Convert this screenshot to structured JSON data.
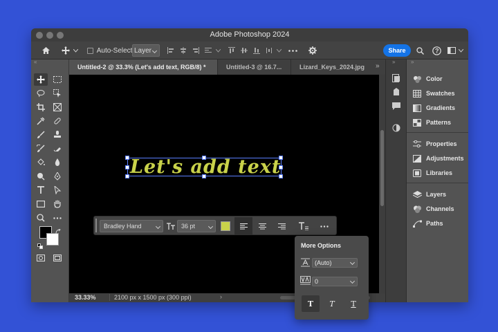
{
  "window": {
    "title": "Adobe Photoshop 2024"
  },
  "options_bar": {
    "auto_select_label": "Auto-Select:",
    "auto_select_value": "Layer",
    "share_label": "Share"
  },
  "tabs": [
    {
      "label": "Untitled-2 @ 33.3% (Let's add text, RGB/8) *",
      "active": true
    },
    {
      "label": "Untitled-3 @ 16.7...",
      "active": false
    },
    {
      "label": "Lizard_Keys_2024.jpg",
      "active": false
    }
  ],
  "canvas": {
    "text": "Let's add text",
    "text_color": "#c9d24a"
  },
  "status": {
    "zoom": "33.33%",
    "doc_info": "2100 px x 1500 px (300 ppi)"
  },
  "context_toolbar": {
    "font_family": "Bradley Hand",
    "font_size": "36 pt",
    "color_swatch": "#c9d24a"
  },
  "panels": [
    {
      "label": "Color",
      "icon": "color-wheel-icon"
    },
    {
      "label": "Swatches",
      "icon": "grid-icon"
    },
    {
      "label": "Gradients",
      "icon": "gradient-icon"
    },
    {
      "label": "Patterns",
      "icon": "pattern-icon"
    },
    {
      "label": "Properties",
      "icon": "sliders-icon"
    },
    {
      "label": "Adjustments",
      "icon": "adjustments-icon"
    },
    {
      "label": "Libraries",
      "icon": "libraries-icon"
    },
    {
      "label": "Layers",
      "icon": "layers-icon"
    },
    {
      "label": "Channels",
      "icon": "channels-icon"
    },
    {
      "label": "Paths",
      "icon": "paths-icon"
    }
  ],
  "more_options": {
    "title": "More Options",
    "leading_value": "(Auto)",
    "tracking_value": "0"
  },
  "colors": {
    "accent": "#1473e6",
    "background": "#3352d6",
    "text_color": "#c9d24a"
  }
}
